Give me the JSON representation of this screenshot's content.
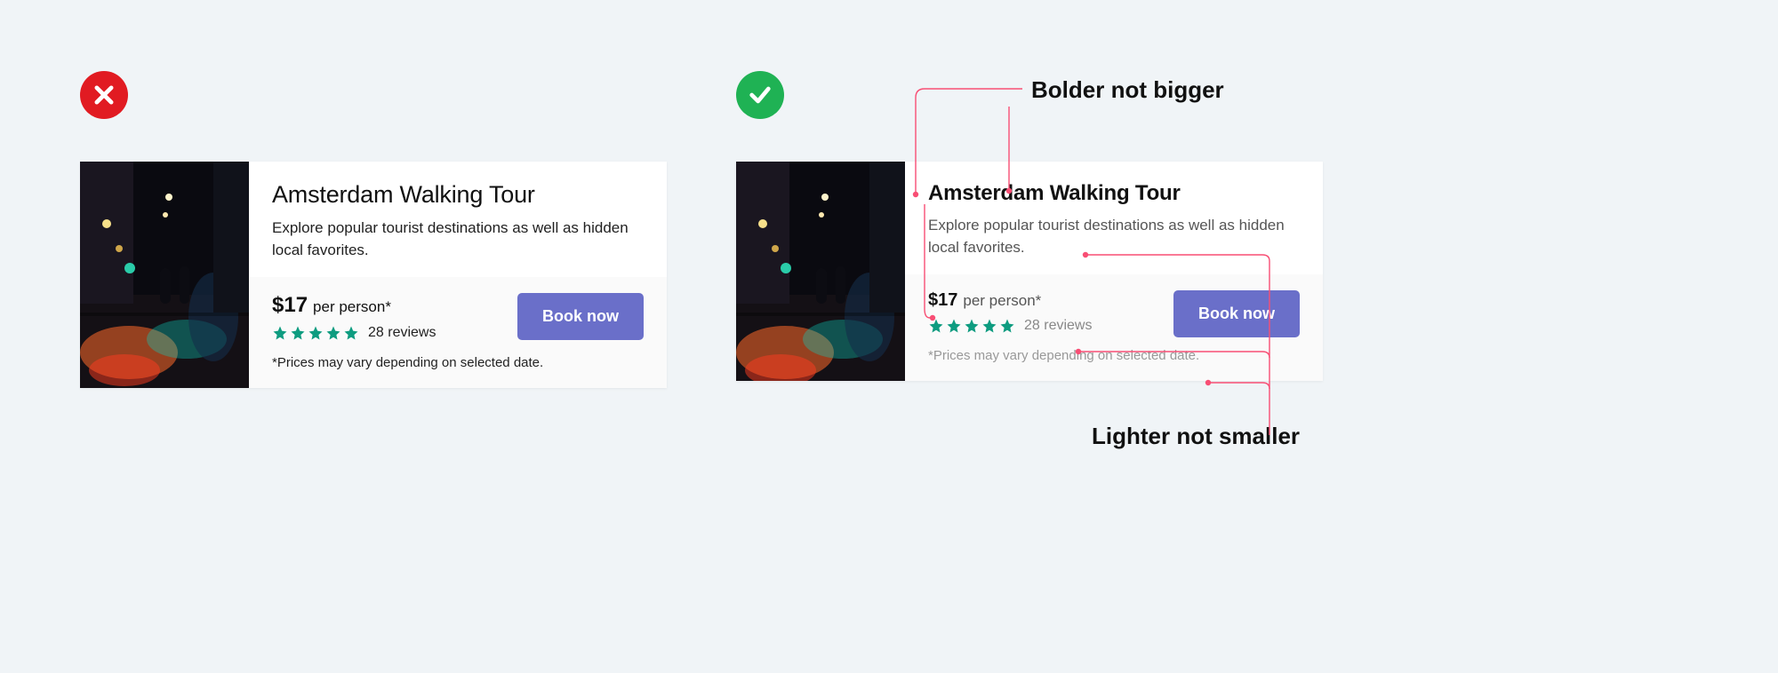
{
  "annotations": {
    "top": "Bolder not bigger",
    "bottom": "Lighter not smaller"
  },
  "card": {
    "title": "Amsterdam Walking Tour",
    "description": "Explore popular tourist destinations as well as hidden local favorites.",
    "price_amount": "$17",
    "price_unit": "per person*",
    "reviews_count": "28 reviews",
    "disclaimer": "*Prices may vary depending on selected date.",
    "cta": "Book now"
  },
  "status": {
    "bad": "cross",
    "good": "check"
  },
  "colors": {
    "bad": "#e11b22",
    "good": "#1fb254",
    "cta": "#6a6fc9",
    "star": "#0e9c80",
    "pointer": "#f84e74"
  }
}
